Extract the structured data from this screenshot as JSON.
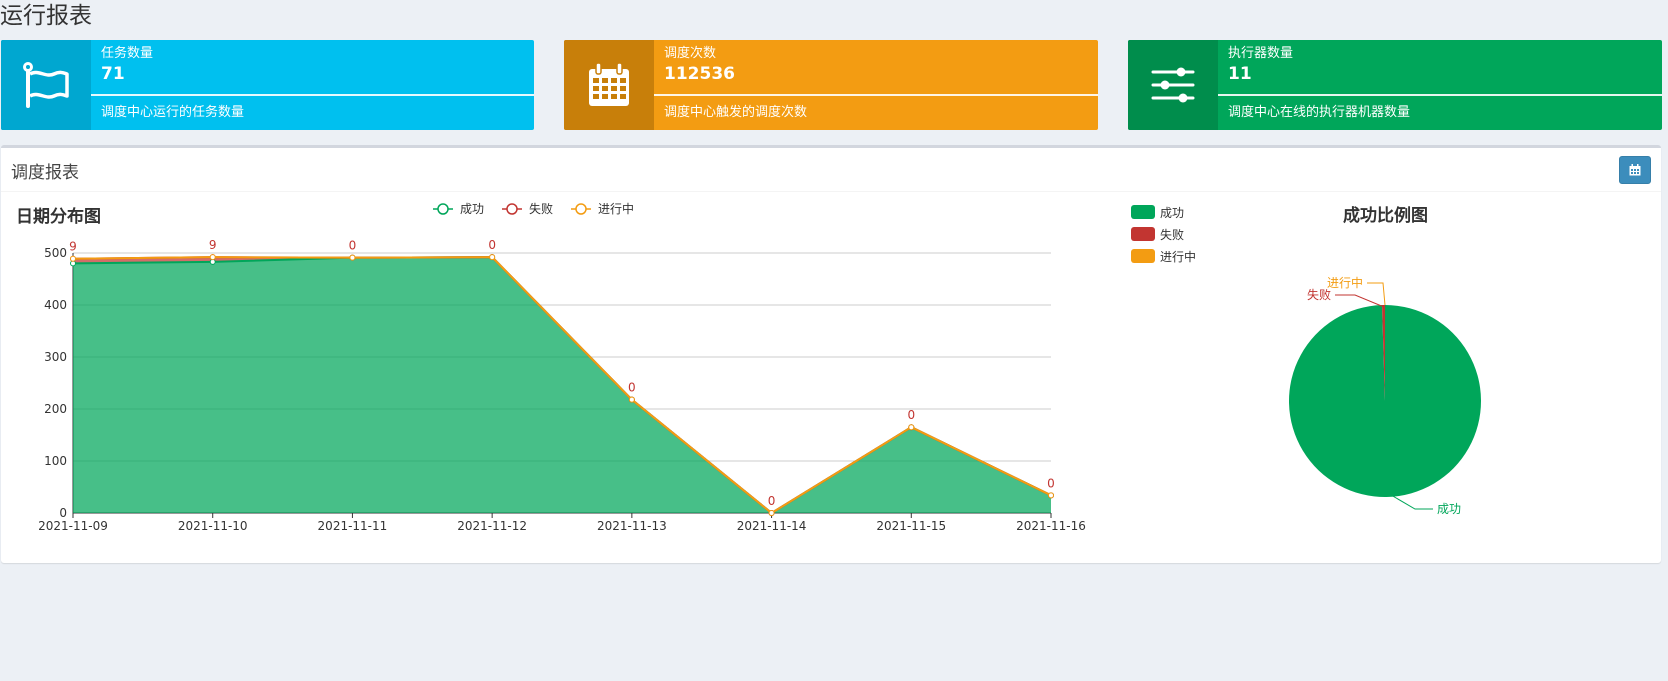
{
  "page": {
    "title": "运行报表"
  },
  "info_boxes": [
    {
      "label": "任务数量",
      "value": "71",
      "description": "调度中心运行的任务数量",
      "color": "#00c0ef",
      "icon_bg": "#00a7d0",
      "icon": "flag-icon"
    },
    {
      "label": "调度次数",
      "value": "112536",
      "description": "调度中心触发的调度次数",
      "color": "#f39c12",
      "icon_bg": "#c87f0a",
      "icon": "calendar-icon"
    },
    {
      "label": "执行器数量",
      "value": "11",
      "description": "调度中心在线的执行器机器数量",
      "color": "#00a65a",
      "icon_bg": "#008d4c",
      "icon": "sliders-icon"
    }
  ],
  "report": {
    "title": "调度报表",
    "calendar_button_icon": "calendar-icon"
  },
  "line_chart": {
    "heading": "日期分布图"
  },
  "pie_chart": {
    "heading": "成功比例图"
  },
  "chart_data": [
    {
      "type": "area",
      "title": "日期分布图",
      "categories": [
        "2021-11-09",
        "2021-11-10",
        "2021-11-11",
        "2021-11-12",
        "2021-11-13",
        "2021-11-14",
        "2021-11-15",
        "2021-11-16"
      ],
      "ylim": [
        0,
        500
      ],
      "yticks": [
        0,
        100,
        200,
        300,
        400,
        500
      ],
      "legend": "top-center",
      "grid": true,
      "series": [
        {
          "name": "成功",
          "color": "#00a65a",
          "values": [
            480,
            483,
            491,
            492,
            218,
            0,
            165,
            34
          ]
        },
        {
          "name": "失败",
          "color": "#c23531",
          "values": [
            9,
            9,
            0,
            0,
            0,
            0,
            0,
            0
          ],
          "labels": [
            "9",
            "9",
            "0",
            "0",
            "0",
            "0",
            "0",
            "0"
          ]
        },
        {
          "name": "进行中",
          "color": "#f39c12",
          "values": [
            0,
            0,
            0,
            0,
            0,
            0,
            0,
            0
          ]
        }
      ]
    },
    {
      "type": "pie",
      "title": "成功比例图",
      "legend": "top-left",
      "slices": [
        {
          "name": "成功",
          "color": "#00a65a",
          "value": 99.5
        },
        {
          "name": "失败",
          "color": "#c23531",
          "value": 0.5
        },
        {
          "name": "进行中",
          "color": "#f39c12",
          "value": 0.0
        }
      ]
    }
  ]
}
